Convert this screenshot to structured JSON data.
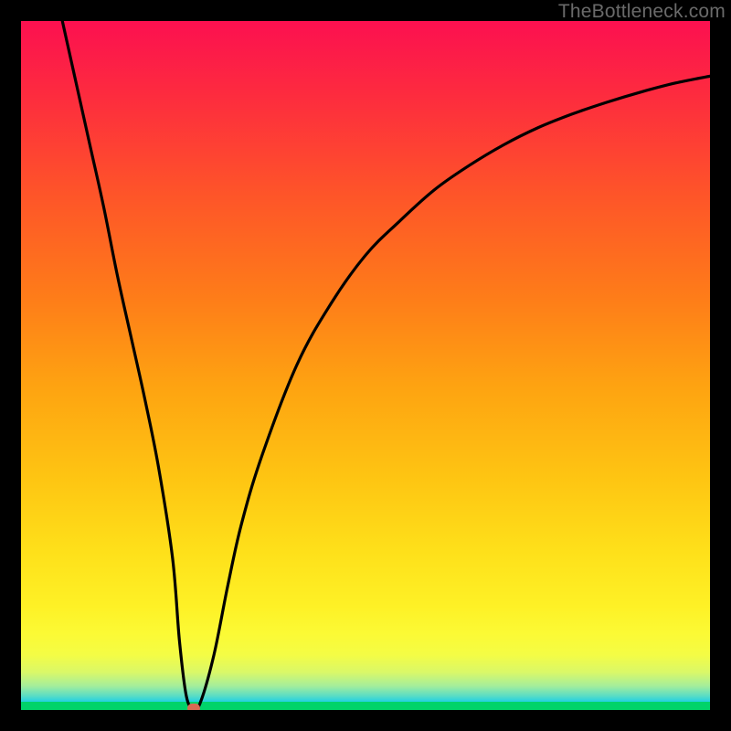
{
  "watermark": "TheBottleneck.com",
  "chart_data": {
    "type": "line",
    "title": "",
    "xlabel": "",
    "ylabel": "",
    "xlim": [
      0,
      100
    ],
    "ylim": [
      0,
      100
    ],
    "grid": false,
    "series": [
      {
        "name": "curve",
        "x": [
          6,
          8,
          10,
          12,
          14,
          16,
          18,
          20,
          22,
          23,
          24,
          25,
          26,
          28,
          30,
          32,
          35,
          40,
          45,
          50,
          55,
          60,
          65,
          70,
          75,
          80,
          85,
          90,
          95,
          100
        ],
        "values": [
          100,
          91,
          82,
          73,
          63,
          54,
          45,
          35,
          22,
          10,
          2,
          0.3,
          1,
          8,
          18,
          27,
          37,
          50,
          59,
          66,
          71,
          75.5,
          79,
          82,
          84.5,
          86.5,
          88.2,
          89.7,
          91,
          92
        ]
      }
    ],
    "marker": {
      "x": 25,
      "y": 0.3
    },
    "background_gradient": {
      "orientation": "vertical",
      "stops": [
        {
          "pos": 0,
          "color": "#fc1050"
        },
        {
          "pos": 50,
          "color": "#fead10"
        },
        {
          "pos": 90,
          "color": "#fcfa30"
        },
        {
          "pos": 100,
          "color": "#00d36a"
        }
      ]
    }
  }
}
